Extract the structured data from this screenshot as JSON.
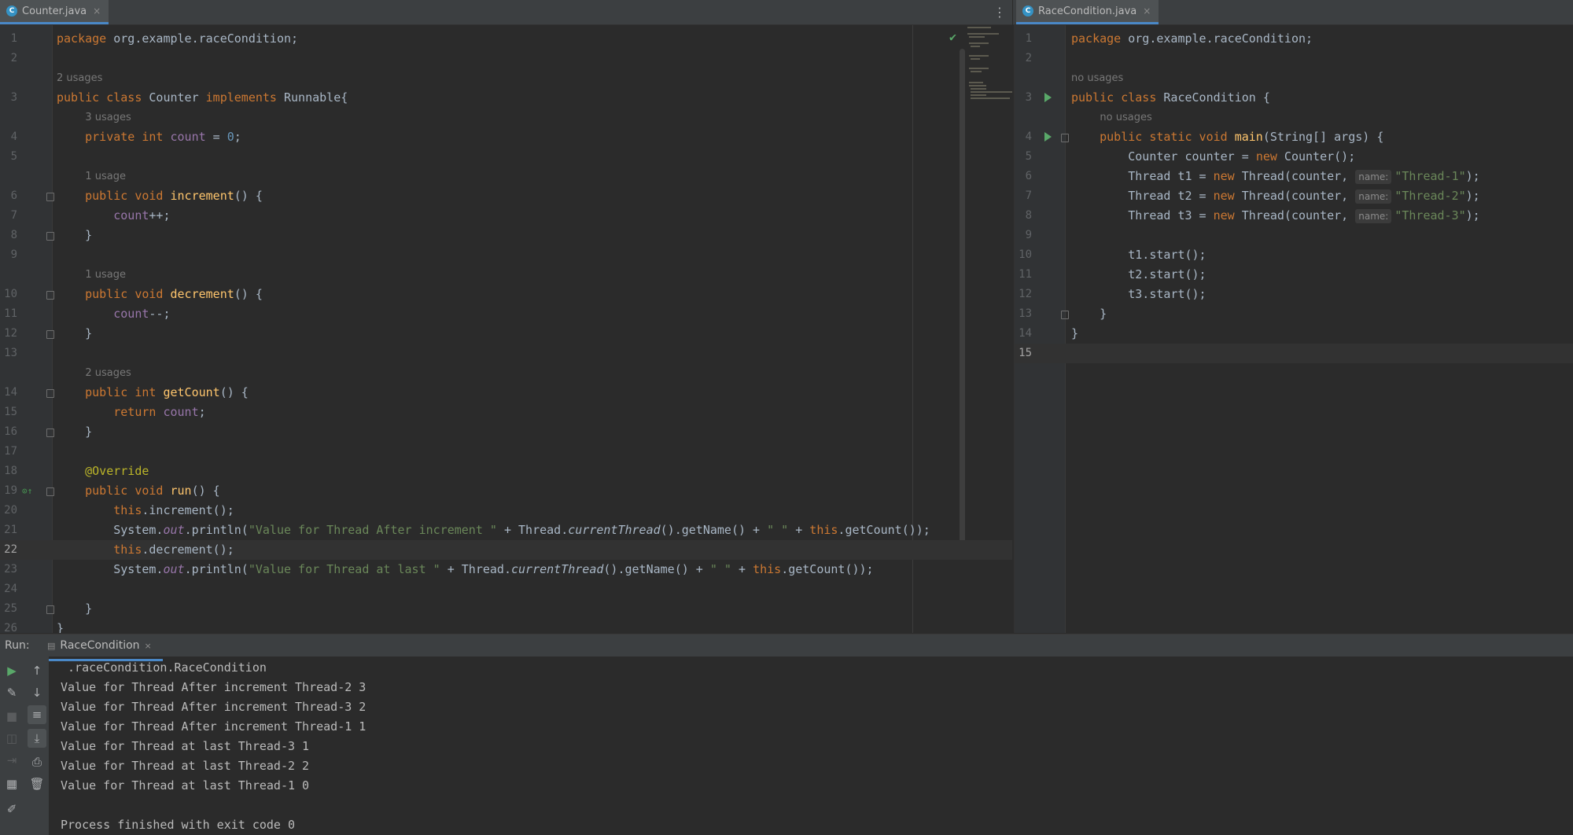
{
  "left_tab": {
    "label": "Counter.java",
    "close": "×"
  },
  "right_tab": {
    "label": "RaceCondition.java",
    "close": "×"
  },
  "more_icon": "⋮",
  "left_lines": [
    {
      "n": "1",
      "html": "<span class=\"kw\">package</span> org.example.raceCondition;"
    },
    {
      "n": "2",
      "html": ""
    },
    {
      "hint": "2 usages",
      "indent": 0
    },
    {
      "n": "3",
      "html": "<span class=\"kw\">public class</span> Counter <span class=\"kw\">implements</span> Runnable{"
    },
    {
      "hint": "3 usages",
      "indent": 4
    },
    {
      "n": "4",
      "html": "    <span class=\"kw\">private int</span> <span class=\"fld\">count</span> = <span class=\"num\">0</span>;"
    },
    {
      "n": "5",
      "html": ""
    },
    {
      "hint": "1 usage",
      "indent": 4
    },
    {
      "n": "6",
      "html": "    <span class=\"kw\">public void</span> <span class=\"fn\">increment</span>() {"
    },
    {
      "n": "7",
      "html": "        <span class=\"fld\">count</span>++;"
    },
    {
      "n": "8",
      "html": "    }"
    },
    {
      "n": "9",
      "html": ""
    },
    {
      "hint": "1 usage",
      "indent": 4
    },
    {
      "n": "10",
      "html": "    <span class=\"kw\">public void</span> <span class=\"fn\">decrement</span>() {"
    },
    {
      "n": "11",
      "html": "        <span class=\"fld\">count</span>--;"
    },
    {
      "n": "12",
      "html": "    }"
    },
    {
      "n": "13",
      "html": ""
    },
    {
      "hint": "2 usages",
      "indent": 4
    },
    {
      "n": "14",
      "html": "    <span class=\"kw\">public int</span> <span class=\"fn\">getCount</span>() {"
    },
    {
      "n": "15",
      "html": "        <span class=\"kw\">return</span> <span class=\"fld\">count</span>;"
    },
    {
      "n": "16",
      "html": "    }"
    },
    {
      "n": "17",
      "html": ""
    },
    {
      "n": "18",
      "html": "    <span class=\"ann\">@Override</span>"
    },
    {
      "n": "19",
      "html": "    <span class=\"kw\">public void</span> <span class=\"fn\">run</span>() {"
    },
    {
      "n": "20",
      "html": "        <span class=\"kw\">this</span>.increment();"
    },
    {
      "n": "21",
      "html": "        System.<span class=\"fld it\">out</span>.println(<span class=\"str\">\"Value for Thread After increment \"</span> + Thread.<span class=\"it\">currentThread</span>().getName() + <span class=\"str\">\" \"</span> + <span class=\"kw\">this</span>.getCount());"
    },
    {
      "n": "22",
      "html": "        <span class=\"kw\">this</span>.decrement();",
      "current": true
    },
    {
      "n": "23",
      "html": "        System.<span class=\"fld it\">out</span>.println(<span class=\"str\">\"Value for Thread at last \"</span> + Thread.<span class=\"it\">currentThread</span>().getName() + <span class=\"str\">\" \"</span> + <span class=\"kw\">this</span>.getCount());"
    },
    {
      "n": "24",
      "html": ""
    },
    {
      "n": "25",
      "html": "    }"
    },
    {
      "n": "26",
      "html": "}"
    }
  ],
  "right_lines": [
    {
      "n": "1",
      "html": "<span class=\"kw\">package</span> org.example.raceCondition;"
    },
    {
      "n": "2",
      "html": ""
    },
    {
      "hint": "no usages",
      "indent": 0
    },
    {
      "n": "3",
      "html": "<span class=\"kw\">public class</span> RaceCondition {"
    },
    {
      "hint": "no usages",
      "indent": 4
    },
    {
      "n": "4",
      "html": "    <span class=\"kw\">public static void</span> <span class=\"fn\">main</span>(String[] args) {"
    },
    {
      "n": "5",
      "html": "        Counter counter = <span class=\"kw\">new</span> Counter();"
    },
    {
      "n": "6",
      "html": "        Thread t1 = <span class=\"kw\">new</span> Thread(counter, <span class=\"pill\">name:</span><span class=\"str\">\"Thread-1\"</span>);"
    },
    {
      "n": "7",
      "html": "        Thread t2 = <span class=\"kw\">new</span> Thread(counter, <span class=\"pill\">name:</span><span class=\"str\">\"Thread-2\"</span>);"
    },
    {
      "n": "8",
      "html": "        Thread t3 = <span class=\"kw\">new</span> Thread(counter, <span class=\"pill\">name:</span><span class=\"str\">\"Thread-3\"</span>);"
    },
    {
      "n": "9",
      "html": ""
    },
    {
      "n": "10",
      "html": "        t1.start();"
    },
    {
      "n": "11",
      "html": "        t2.start();"
    },
    {
      "n": "12",
      "html": "        t3.start();"
    },
    {
      "n": "13",
      "html": "    }"
    },
    {
      "n": "14",
      "html": "}"
    },
    {
      "n": "15",
      "html": "",
      "current": true
    }
  ],
  "run_panel": {
    "label": "Run:",
    "tab": "RaceCondition",
    "close": "×",
    "output": [
      " .raceCondition.RaceCondition",
      "Value for Thread After increment Thread-2 3",
      "Value for Thread After increment Thread-3 2",
      "Value for Thread After increment Thread-1 1",
      "Value for Thread at last Thread-3 1",
      "Value for Thread at last Thread-2 2",
      "Value for Thread at last Thread-1 0",
      "",
      "Process finished with exit code 0"
    ]
  },
  "colors": {
    "keyword": "#cc7832",
    "string": "#6a8759",
    "field": "#9876aa",
    "function": "#ffc66d",
    "number": "#6897bb",
    "accent": "#4a88c7"
  }
}
